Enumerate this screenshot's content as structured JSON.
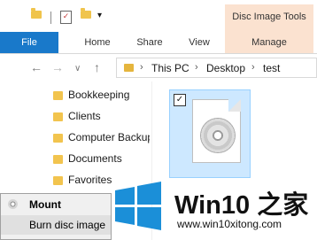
{
  "quick_access": {
    "customize_glyph": "▾"
  },
  "ribbon": {
    "context_header": "Disc Image Tools",
    "tabs": [
      {
        "label": "File"
      },
      {
        "label": "Home"
      },
      {
        "label": "Share"
      },
      {
        "label": "View"
      },
      {
        "label": "Manage"
      }
    ]
  },
  "navigation": {
    "back_glyph": "←",
    "forward_glyph": "→",
    "dropdown_glyph": "∨",
    "up_glyph": "↑",
    "breadcrumb_separator": "›",
    "breadcrumb": [
      "This PC",
      "Desktop",
      "test"
    ]
  },
  "nav_pane": {
    "items": [
      {
        "label": "Bookkeeping"
      },
      {
        "label": "Clients"
      },
      {
        "label": "Computer Backups"
      },
      {
        "label": "Documents"
      },
      {
        "label": "Favorites"
      }
    ]
  },
  "file_item": {
    "checkbox_glyph": "✓",
    "selected": true,
    "icon": "disc-image-file-icon"
  },
  "context_menu": {
    "items": [
      {
        "label": "Mount",
        "bold": true
      },
      {
        "label": "Burn disc image",
        "highlighted": true
      }
    ]
  },
  "watermark": {
    "title": "Win10 之家",
    "url": "www.win10xitong.com",
    "logo_color": "#1b8fd8"
  },
  "colors": {
    "file_tab": "#1979ca",
    "context_tab": "#fbe2d0",
    "selection": "#cde8ff",
    "folder": "#f2c44e"
  }
}
